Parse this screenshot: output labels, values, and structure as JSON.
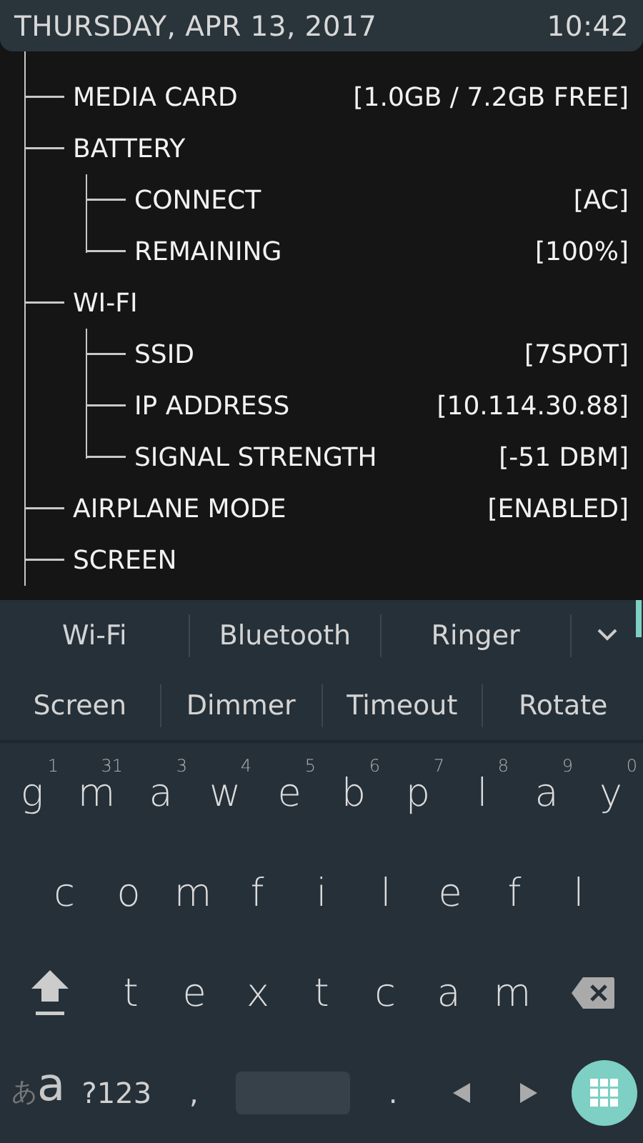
{
  "status_bar": {
    "date": "THURSDAY, APR 13, 2017",
    "time": "10:42"
  },
  "tree": [
    {
      "label": "MEDIA CARD",
      "value": "[1.0GB / 7.2GB FREE]"
    },
    {
      "label": "BATTERY",
      "children": [
        {
          "label": "CONNECT",
          "value": "[AC]"
        },
        {
          "label": "REMAINING",
          "value": "[100%]"
        }
      ]
    },
    {
      "label": "WI-FI",
      "children": [
        {
          "label": "SSID",
          "value": "[7SPOT]"
        },
        {
          "label": "IP ADDRESS",
          "value": "[10.114.30.88]"
        },
        {
          "label": "SIGNAL STRENGTH",
          "value": "[-51 DBM]"
        }
      ]
    },
    {
      "label": "AIRPLANE MODE",
      "value": "[ENABLED]"
    },
    {
      "label": "SCREEN"
    }
  ],
  "suggestions": [
    [
      "Wi-Fi",
      "Bluetooth",
      "Ringer"
    ],
    [
      "Screen",
      "Dimmer",
      "Timeout",
      "Rotate"
    ]
  ],
  "keyboard": {
    "rows": [
      [
        {
          "label": "g",
          "hint": "1"
        },
        {
          "label": "m",
          "hint": "31"
        },
        {
          "label": "a",
          "hint": "3"
        },
        {
          "label": "w",
          "hint": "4"
        },
        {
          "label": "e",
          "hint": "5"
        },
        {
          "label": "b",
          "hint": "6"
        },
        {
          "label": "p",
          "hint": "7"
        },
        {
          "label": "l",
          "hint": "8"
        },
        {
          "label": "a",
          "hint": "9"
        },
        {
          "label": "y",
          "hint": "0"
        }
      ],
      [
        {
          "label": "c"
        },
        {
          "label": "o"
        },
        {
          "label": "m"
        },
        {
          "label": "f"
        },
        {
          "label": "i"
        },
        {
          "label": "l"
        },
        {
          "label": "e"
        },
        {
          "label": "f"
        },
        {
          "label": "l"
        }
      ],
      [
        {
          "label": "t"
        },
        {
          "label": "e"
        },
        {
          "label": "x"
        },
        {
          "label": "t"
        },
        {
          "label": "c"
        },
        {
          "label": "a"
        },
        {
          "label": "m"
        }
      ]
    ],
    "bottom_row": [
      {
        "kind": "lang",
        "label": "あ",
        "label_2": "a"
      },
      {
        "kind": "text",
        "label": "?123"
      },
      {
        "kind": "text",
        "label": ","
      },
      {
        "kind": "space"
      },
      {
        "kind": "text",
        "label": "."
      },
      {
        "kind": "left"
      },
      {
        "kind": "right"
      },
      {
        "kind": "grid"
      }
    ]
  }
}
